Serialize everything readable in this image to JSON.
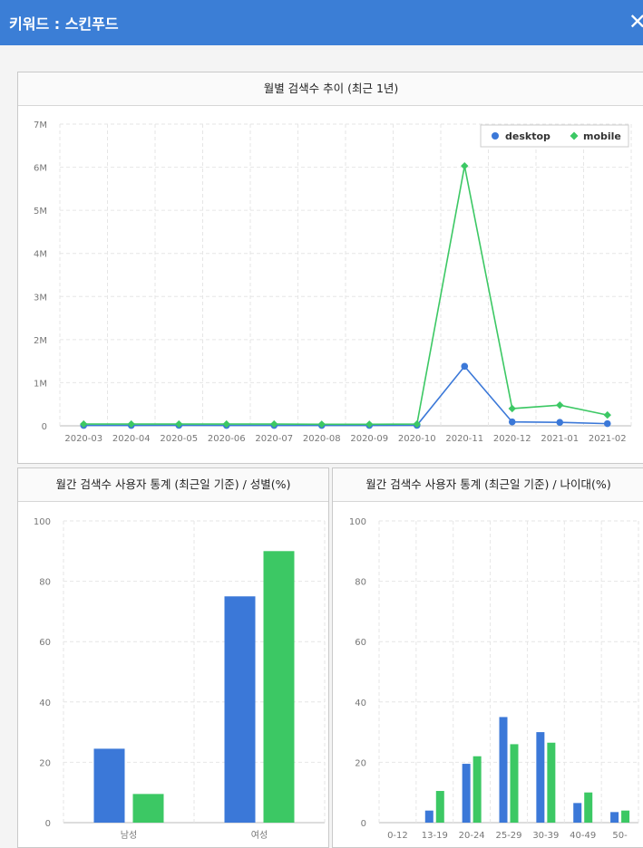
{
  "header": {
    "title": "키워드 : 스킨푸드",
    "close_glyph": "✕"
  },
  "colors": {
    "desktop": "#3b78d8",
    "mobile": "#3cc864",
    "header_bg": "#3b7ed6"
  },
  "chart_data": [
    {
      "type": "line",
      "title": "월별 검색수 추이 (최근 1년)",
      "categories": [
        "2020-03",
        "2020-04",
        "2020-05",
        "2020-06",
        "2020-07",
        "2020-08",
        "2020-09",
        "2020-10",
        "2020-11",
        "2020-12",
        "2021-01",
        "2021-02"
      ],
      "series": [
        {
          "name": "desktop",
          "values": [
            10000,
            10000,
            12000,
            10000,
            10000,
            10000,
            10000,
            12000,
            1380000,
            90000,
            80000,
            50000
          ]
        },
        {
          "name": "mobile",
          "values": [
            40000,
            40000,
            40000,
            40000,
            40000,
            35000,
            35000,
            40000,
            6030000,
            400000,
            480000,
            250000
          ]
        }
      ],
      "ylim": [
        0,
        7000000
      ],
      "yticks": [
        "0",
        "1M",
        "2M",
        "3M",
        "4M",
        "5M",
        "6M",
        "7M"
      ],
      "legend_position": "top-right",
      "grid": true
    },
    {
      "type": "bar",
      "title": "월간 검색수 사용자 통계 (최근일 기준) / 성별(%)",
      "categories": [
        "남성",
        "여성"
      ],
      "series": [
        {
          "name": "desktop",
          "values": [
            24.5,
            75
          ]
        },
        {
          "name": "mobile",
          "values": [
            9.5,
            90
          ]
        }
      ],
      "ylim": [
        0,
        100
      ],
      "yticks": [
        "0",
        "20",
        "40",
        "60",
        "80",
        "100"
      ],
      "grid": true
    },
    {
      "type": "bar",
      "title": "월간 검색수 사용자 통계 (최근일 기준) / 나이대(%)",
      "categories": [
        "0-12",
        "13-19",
        "20-24",
        "25-29",
        "30-39",
        "40-49",
        "50-"
      ],
      "series": [
        {
          "name": "desktop",
          "values": [
            0,
            4,
            19.5,
            35,
            30,
            6.5,
            3.5
          ]
        },
        {
          "name": "mobile",
          "values": [
            0,
            10.5,
            22,
            26,
            26.5,
            10,
            4
          ]
        }
      ],
      "ylim": [
        0,
        100
      ],
      "yticks": [
        "0",
        "20",
        "40",
        "60",
        "80",
        "100"
      ],
      "grid": true
    }
  ]
}
